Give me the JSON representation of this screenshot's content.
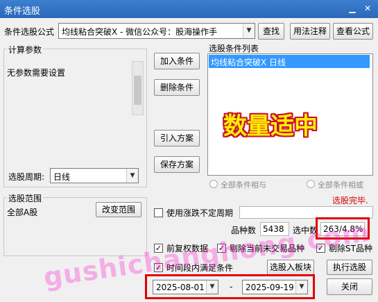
{
  "window": {
    "title": "条件选股"
  },
  "formula": {
    "label": "条件选股公式",
    "value": "均线粘合突破X  -  微信公众号：股海操作手",
    "find": "查找",
    "usage": "用法注释",
    "view": "查看公式"
  },
  "params": {
    "group_label": "计算参数",
    "text": "无参数需要设置",
    "period_label": "选股周期:",
    "period_value": "日线"
  },
  "mid_buttons": {
    "add": "加入条件",
    "delete": "删除条件",
    "import": "引入方案",
    "save": "保存方案"
  },
  "conditions": {
    "group_label": "选股条件列表",
    "items": [
      "均线粘合突破X  日线"
    ],
    "overlay": "数量适中"
  },
  "logic": {
    "and": "全部条件相与",
    "or": "全部条件相或"
  },
  "status": "选股完毕.",
  "scope": {
    "group_label": "选股范围",
    "value": "全部A股",
    "change": "改变范围"
  },
  "options": {
    "uncertain_period": "使用涨跌不定周期",
    "count_label": "品种数",
    "count_value": "5438",
    "selected_label": "选中数",
    "selected_value": "263/4.8%",
    "pre_adjust": "前复权数据",
    "exclude_untraded": "剔除当前未交易品种",
    "exclude_st": "剔除ST品种",
    "time_range": "时间段内满足条件",
    "to_board": "选股入板块",
    "execute": "执行选股",
    "close": "关闭"
  },
  "dates": {
    "start": "2025-08-01",
    "sep": "-",
    "end": "2025-09-19"
  },
  "watermark": "gushichanghong.com",
  "colors": {
    "title_bar": "#2b68b8",
    "selection": "#3399ff",
    "overlay_text": "#ffef00",
    "overlay_outline": "#c8102e",
    "highlight_box": "#e00000",
    "status_text": "#d00000"
  }
}
